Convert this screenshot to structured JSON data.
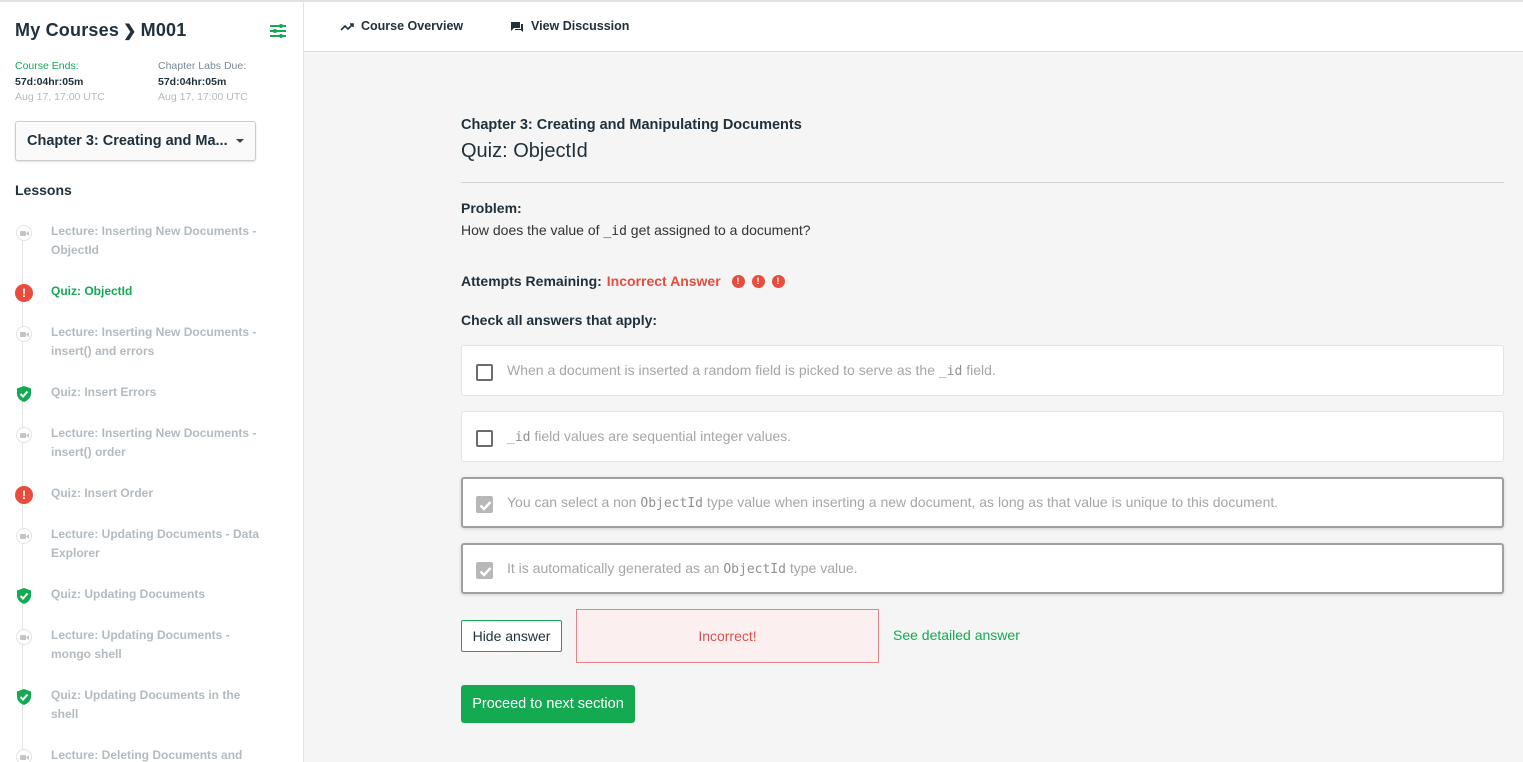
{
  "sidebar": {
    "breadcrumb": {
      "root": "My Courses",
      "separator": "❯",
      "course": "M001"
    },
    "deadlines": [
      {
        "label": "Course Ends:",
        "countdown": "57d:04hr:05m",
        "date": "Aug 17, 17:00 UTC"
      },
      {
        "label": "Chapter Labs Due:",
        "countdown": "57d:04hr:05m",
        "date": "Aug 17, 17:00 UTC"
      }
    ],
    "chapter_select": {
      "value": "Chapter 3: Creating and Ma..."
    },
    "lessons_heading": "Lessons",
    "lessons": [
      {
        "label": "Lecture: Inserting New Documents - ObjectId",
        "icon": "video-icon",
        "status": "none"
      },
      {
        "label": "Quiz: ObjectId",
        "icon": "error-icon",
        "status": "incorrect",
        "active": true
      },
      {
        "label": "Lecture: Inserting New Documents - insert() and errors",
        "icon": "video-icon",
        "status": "none"
      },
      {
        "label": "Quiz: Insert Errors",
        "icon": "shield-check-icon",
        "status": "correct"
      },
      {
        "label": "Lecture: Inserting New Documents - insert() order",
        "icon": "video-icon",
        "status": "none"
      },
      {
        "label": "Quiz: Insert Order",
        "icon": "error-icon",
        "status": "incorrect"
      },
      {
        "label": "Lecture: Updating Documents - Data Explorer",
        "icon": "video-icon",
        "status": "none"
      },
      {
        "label": "Quiz: Updating Documents",
        "icon": "shield-check-icon",
        "status": "correct"
      },
      {
        "label": "Lecture: Updating Documents - mongo shell",
        "icon": "video-icon",
        "status": "none"
      },
      {
        "label": "Quiz: Updating Documents in the shell",
        "icon": "shield-check-icon",
        "status": "correct"
      },
      {
        "label": "Lecture: Deleting Documents and",
        "icon": "video-icon",
        "status": "none"
      }
    ]
  },
  "topnav": {
    "overview_label": "Course Overview",
    "discussion_label": "View Discussion"
  },
  "main": {
    "chapter_title": "Chapter 3: Creating and Manipulating Documents",
    "quiz_title": "Quiz: ObjectId",
    "problem_heading": "Problem:",
    "problem": {
      "pre": "How does the value of ",
      "code": "_id",
      "post": " get assigned to a document?"
    },
    "attempts_label": "Attempts Remaining:",
    "attempts_status": "Incorrect Answer",
    "attempt_marks": [
      "!",
      "!",
      "!"
    ],
    "check_heading": "Check all answers that apply:",
    "options": [
      {
        "pre": "When a document is inserted a random field is picked to serve as the ",
        "code": "_id",
        "post": " field.",
        "checked": false
      },
      {
        "pre": "",
        "code": "_id",
        "post": " field values are sequential integer values.",
        "checked": false
      },
      {
        "pre": "You can select a non ",
        "code": "ObjectId",
        "post": " type value when inserting a new document, as long as that value is unique to this document.",
        "checked": true
      },
      {
        "pre": "It is automatically generated as an ",
        "code": "ObjectId",
        "post": " type value.",
        "checked": true
      }
    ],
    "hide_answer_label": "Hide answer",
    "result_text": "Incorrect!",
    "detailed_answer_label": "See detailed answer",
    "proceed_label": "Proceed to next section"
  },
  "colors": {
    "brand_green": "#13aa52",
    "error_red": "#e74c3c",
    "text_dark": "#21313c"
  }
}
